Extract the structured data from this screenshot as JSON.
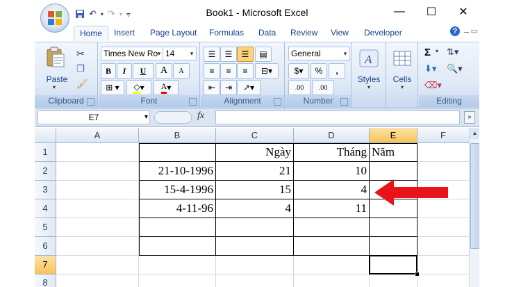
{
  "window": {
    "title": "Book1 - Microsoft Excel"
  },
  "window_controls": {
    "minimize": "—",
    "maximize": "☐",
    "close": "✕"
  },
  "tabs": [
    "Home",
    "Insert",
    "Page Layout",
    "Formulas",
    "Data",
    "Review",
    "View",
    "Developer"
  ],
  "ribbon": {
    "clipboard": {
      "label": "Clipboard",
      "paste": "Paste"
    },
    "font": {
      "label": "Font",
      "name": "Times New Ro",
      "size": "14",
      "bold": "B",
      "italic": "I",
      "underline": "U",
      "grow": "A",
      "shrink": "A",
      "font_color": "A"
    },
    "alignment": {
      "label": "Alignment"
    },
    "number": {
      "label": "Number",
      "format": "General",
      "currency": "$",
      "percent": "%",
      "comma": ",",
      "inc_decimal": ".00",
      "dec_decimal": ".00"
    },
    "styles": {
      "label": "Styles"
    },
    "cells": {
      "label": "Cells"
    },
    "editing": {
      "label": "Editing",
      "sum": "Σ"
    }
  },
  "formula_bar": {
    "name_box": "E7",
    "fx": "fx",
    "value": ""
  },
  "columns": [
    "A",
    "B",
    "C",
    "D",
    "E",
    "F"
  ],
  "rows": [
    "1",
    "2",
    "3",
    "4",
    "5",
    "6",
    "7",
    "8"
  ],
  "cells": {
    "C1": "Ngày",
    "D1": "Tháng",
    "E1": "Năm",
    "B2": "21-10-1996",
    "C2": "21",
    "D2": "10",
    "B3": "15-4-1996",
    "C3": "15",
    "D3": "4",
    "B4": "4-11-96",
    "C4": "4",
    "D4": "11"
  },
  "selected_cell": "E7",
  "colors": {
    "accent_arrow": "#e8131b",
    "header_selected": "#f7c35a"
  }
}
